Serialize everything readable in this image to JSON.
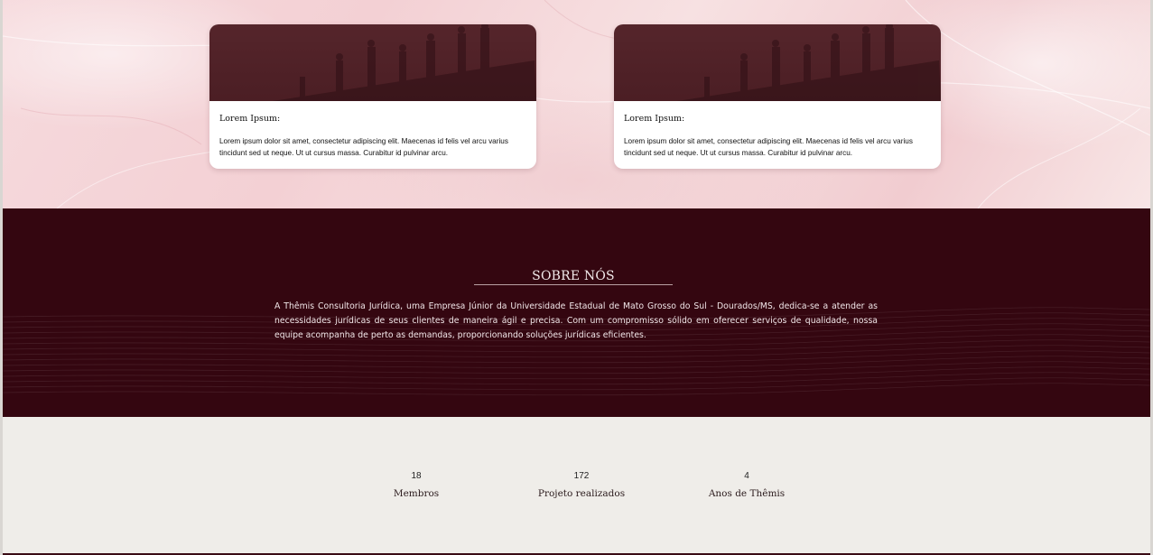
{
  "cards": [
    {
      "title": "Lorem Ipsum:",
      "text": "Lorem ipsum dolor sit amet, consectetur adipiscing elit. Maecenas id felis vel arcu varius tincidunt sed ut neque. Ut ut cursus massa. Curabitur id pulvinar arcu."
    },
    {
      "title": "Lorem Ipsum:",
      "text": "Lorem ipsum dolor sit amet, consectetur adipiscing elit. Maecenas id felis vel arcu varius tincidunt sed ut neque. Ut ut cursus massa. Curabitur id pulvinar arcu."
    }
  ],
  "about": {
    "title": "SOBRE NÓS",
    "text": "A Thêmis Consultoria Jurídica, uma Empresa Júnior da Universidade Estadual de Mato Grosso do Sul - Dourados/MS, dedica-se a atender as necessidades jurídicas de seus clientes de maneira ágil e precisa. Com um compromisso sólido em oferecer serviços de qualidade, nossa equipe acompanha de perto as demandas, proporcionando soluções jurídicas eficientes."
  },
  "stats": [
    {
      "value": "18",
      "label": "Membros"
    },
    {
      "value": "172",
      "label": "Projeto realizados"
    },
    {
      "value": "4",
      "label": "Anos de Thêmis"
    }
  ],
  "colors": {
    "wine": "#340610",
    "card_image": "#4b1e24",
    "stats_bg": "#efede9"
  }
}
